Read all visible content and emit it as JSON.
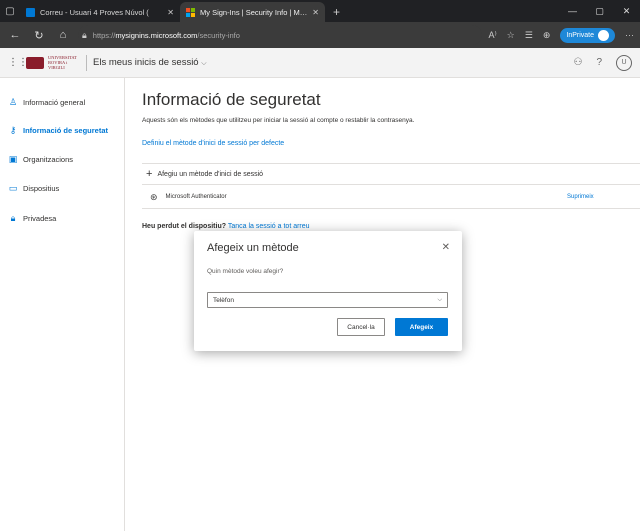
{
  "browser": {
    "tabs": [
      {
        "title": "Correu - Usuari 4 Proves Núvol (",
        "active": false,
        "favicon_color": "#0078d4"
      },
      {
        "title": "My Sign-Ins | Security Info | Micr",
        "active": true,
        "favicon_color": "#f25022"
      }
    ],
    "url_prefix": "https://",
    "url_host": "mysignins.microsoft.com",
    "url_path": "/security-info",
    "inprivate_label": "InPrivate"
  },
  "header": {
    "logo_text": "UNIVERSITAT ROVIRA i VIRGILI",
    "app_title": "Els meus inicis de sessió",
    "avatar_initial": "U"
  },
  "sidebar": {
    "items": [
      {
        "label": "Informació general",
        "icon": "person-icon",
        "active": false
      },
      {
        "label": "Informació de seguretat",
        "icon": "key-icon",
        "active": true
      },
      {
        "label": "Organitzacions",
        "icon": "briefcase-icon",
        "active": false
      },
      {
        "label": "Dispositius",
        "icon": "laptop-icon",
        "active": false
      },
      {
        "label": "Privadesa",
        "icon": "lock-icon",
        "active": false
      }
    ]
  },
  "main": {
    "title": "Informació de seguretat",
    "description": "Aquests són els mètodes que utilitzeu per iniciar la sessió al compte o restablir la contrasenya.",
    "default_link": "Definiu el mètode d'inici de sessió per defecte",
    "add_method": "Afegiu un mètode d'inici de sessió",
    "methods": [
      {
        "name": "Microsoft Authenticator",
        "action": "Suprimeix"
      }
    ],
    "lost_device_bold": "Heu perdut el dispositiu?",
    "lost_device_link": "Tanca la sessió a tot arreu"
  },
  "dialog": {
    "title": "Afegeix un mètode",
    "subtitle": "Quin mètode voleu afegir?",
    "selected": "Telèfon",
    "cancel_label": "Cancel·la",
    "add_label": "Afegeix"
  },
  "colors": {
    "accent": "#0078d4",
    "browser_dark": "#202124",
    "brand": "#8a1c2b"
  }
}
